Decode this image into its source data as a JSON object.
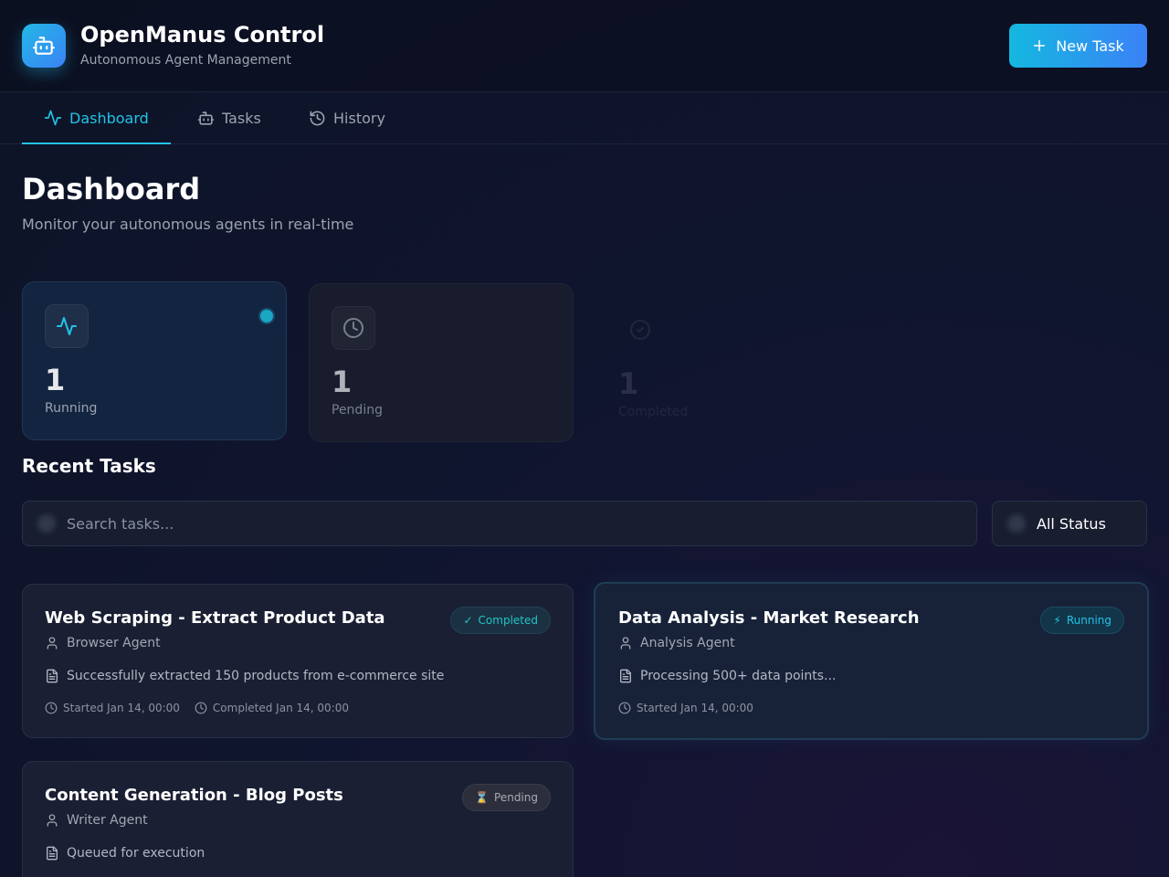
{
  "app": {
    "title": "OpenManus Control",
    "subtitle": "Autonomous Agent Management",
    "new_task_label": "New Task",
    "logo_icon": "robot-icon"
  },
  "nav": {
    "tabs": [
      {
        "label": "Dashboard",
        "icon": "activity-icon",
        "active": true
      },
      {
        "label": "Tasks",
        "icon": "robot-icon",
        "active": false
      },
      {
        "label": "History",
        "icon": "history-icon",
        "active": false
      }
    ]
  },
  "page": {
    "title": "Dashboard",
    "subtitle": "Monitor your autonomous agents in real-time"
  },
  "stats": [
    {
      "value": "1",
      "label": "Running",
      "icon": "activity-icon"
    },
    {
      "value": "1",
      "label": "Pending",
      "icon": "clock-icon"
    },
    {
      "value": "1",
      "label": "Completed",
      "icon": "check-circle-icon"
    }
  ],
  "recent": {
    "title": "Recent Tasks",
    "search_placeholder": "Search tasks...",
    "status_filter": "All Status"
  },
  "tasks": [
    {
      "title": "Web Scraping - Extract Product Data",
      "status": "Completed",
      "status_glyph": "✓",
      "agent": "Browser Agent",
      "description": "Successfully extracted 150 products from e-commerce site",
      "started": "Started Jan 14, 00:00",
      "completed": "Completed Jan 14, 00:00"
    },
    {
      "title": "Data Analysis - Market Research",
      "status": "Running",
      "status_glyph": "⚡",
      "agent": "Analysis Agent",
      "description": "Processing 500+ data points...",
      "started": "Started Jan 14, 00:00"
    },
    {
      "title": "Content Generation - Blog Posts",
      "status": "Pending",
      "status_glyph": "⌛",
      "agent": "Writer Agent",
      "description": "Queued for execution"
    }
  ],
  "colors": {
    "accent": "#22c3e6",
    "button_gradient_start": "#14b8e0",
    "button_gradient_end": "#3b82f6",
    "background": "#0d1426"
  }
}
